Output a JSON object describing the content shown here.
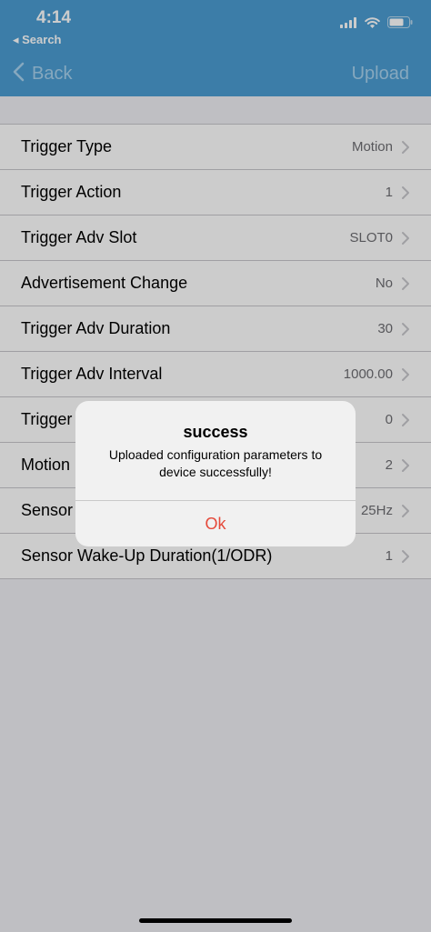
{
  "status_bar": {
    "time": "4:14",
    "back_app": "◂ Search",
    "icons": [
      "cellular-signal-icon",
      "wifi-icon",
      "battery-icon"
    ]
  },
  "nav": {
    "back_label": "Back",
    "upload_label": "Upload"
  },
  "rows": [
    {
      "title": "Trigger Type",
      "value": "Motion"
    },
    {
      "title": "Trigger Action",
      "value": "1"
    },
    {
      "title": "Trigger Adv Slot",
      "value": "SLOT0"
    },
    {
      "title": "Advertisement Change",
      "value": "No"
    },
    {
      "title": "Trigger Adv Duration",
      "value": "30"
    },
    {
      "title": "Trigger Adv Interval",
      "value": "1000.00"
    },
    {
      "title": "Trigger",
      "value": "0"
    },
    {
      "title": "Motion",
      "value": "2"
    },
    {
      "title": "Sensor",
      "value": "25Hz"
    },
    {
      "title": "Sensor Wake-Up Duration(1/ODR)",
      "value": "1"
    }
  ],
  "alert": {
    "title": "success",
    "message": "Uploaded configuration parameters to device successfully!",
    "ok_label": "Ok"
  },
  "colors": {
    "header": "#4b9dd3",
    "nav_text": "#a8d2ee",
    "alert_button": "#e5493a"
  }
}
